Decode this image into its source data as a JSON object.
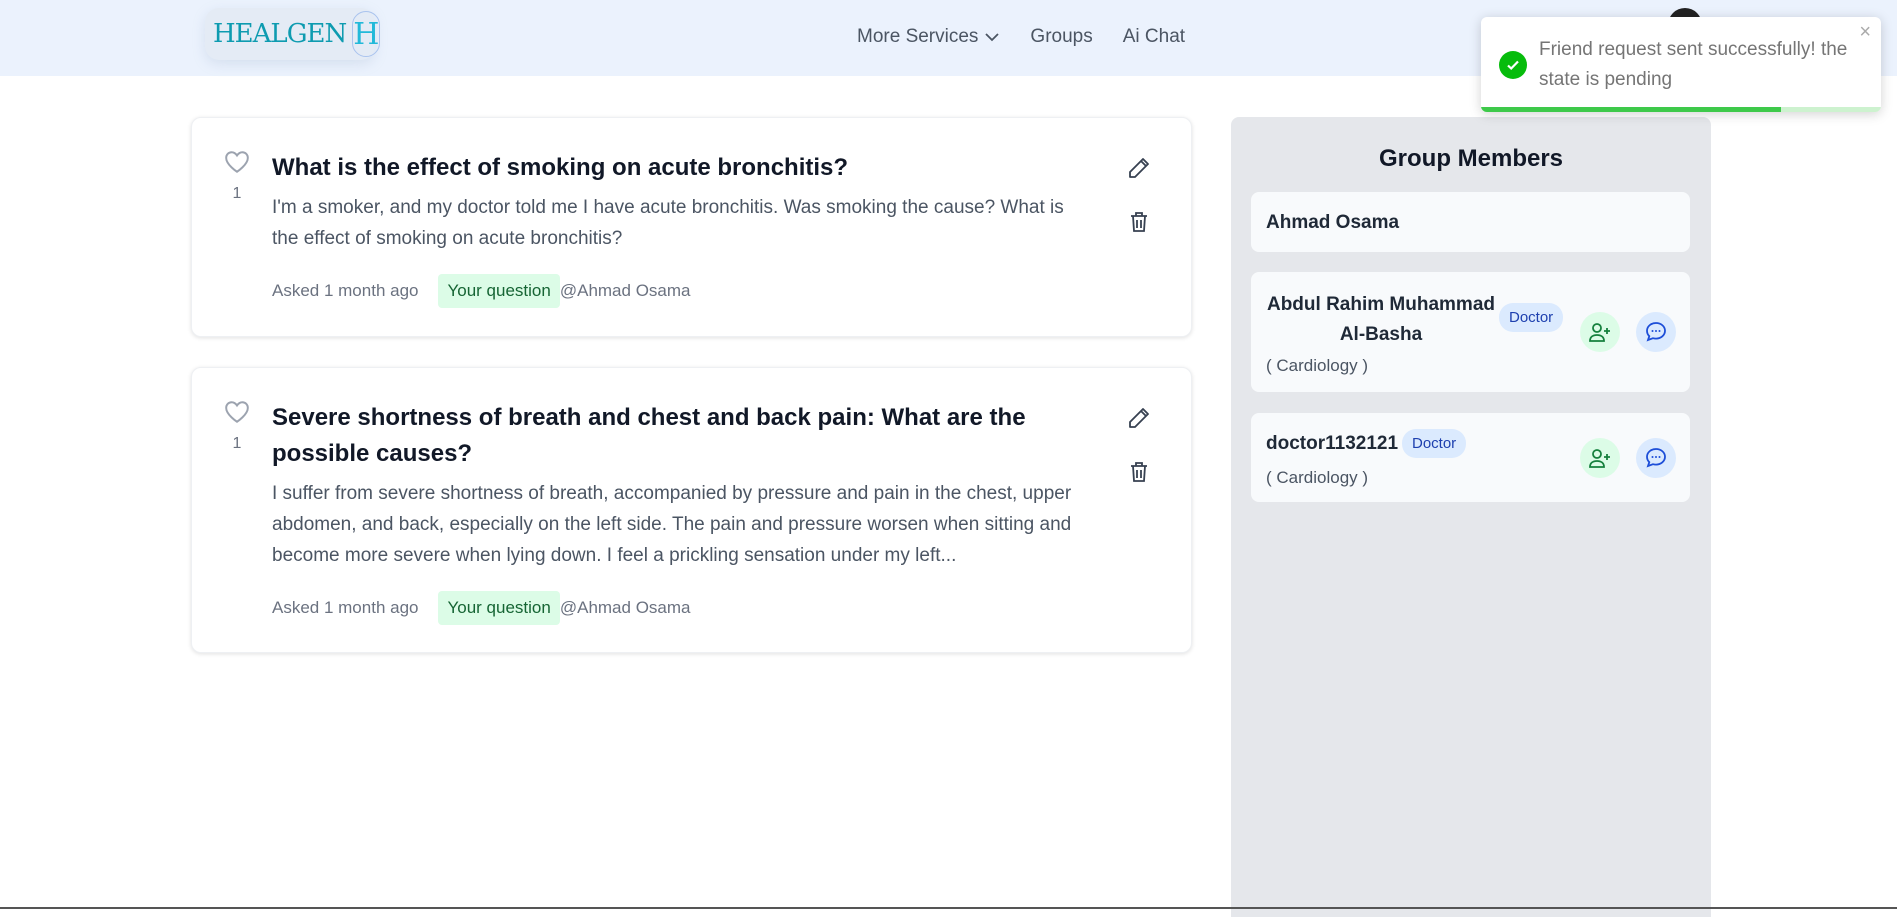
{
  "nav": {
    "logo_text": "HEALGEN",
    "logo_mark": "H",
    "links": [
      {
        "label": "More Services",
        "has_dropdown": true
      },
      {
        "label": "Groups"
      },
      {
        "label": "Ai Chat"
      }
    ]
  },
  "questions": [
    {
      "likes": "1",
      "title": "What is the effect of smoking on acute bronchitis?",
      "body": "I'm a smoker, and my doctor told me I have acute bronchitis. Was smoking the cause? What is the effect of smoking on acute bronchitis?",
      "asked": "Asked 1 month ago",
      "tag": "Your question",
      "author": "@Ahmad Osama"
    },
    {
      "likes": "1",
      "title": "Severe shortness of breath and chest and back pain: What are the possible causes?",
      "body": "I suffer from severe shortness of breath, accompanied by pressure and pain in the chest, upper abdomen, and back, especially on the left side. The pain and pressure worsen when sitting and become more severe when lying down. I feel a prickling sensation under my left...",
      "asked": "Asked 1 month ago",
      "tag": "Your question",
      "author": "@Ahmad Osama"
    }
  ],
  "sidebar": {
    "title": "Group Members",
    "members": [
      {
        "name": "Ahmad Osama"
      },
      {
        "name": "Abdul Rahim Muhammad Al-Basha",
        "badge": "Doctor",
        "specialty": "( Cardiology )"
      },
      {
        "name": "doctor1132121",
        "badge": "Doctor",
        "specialty": "( Cardiology )"
      }
    ]
  },
  "toast": {
    "message": "Friend request sent successfully! the state is pending",
    "progress": 0.75,
    "close": "×"
  },
  "colors": {
    "accent_green": "#07bc0c",
    "badge_blue": "#dbeafe",
    "tag_green": "#dcfce7"
  }
}
